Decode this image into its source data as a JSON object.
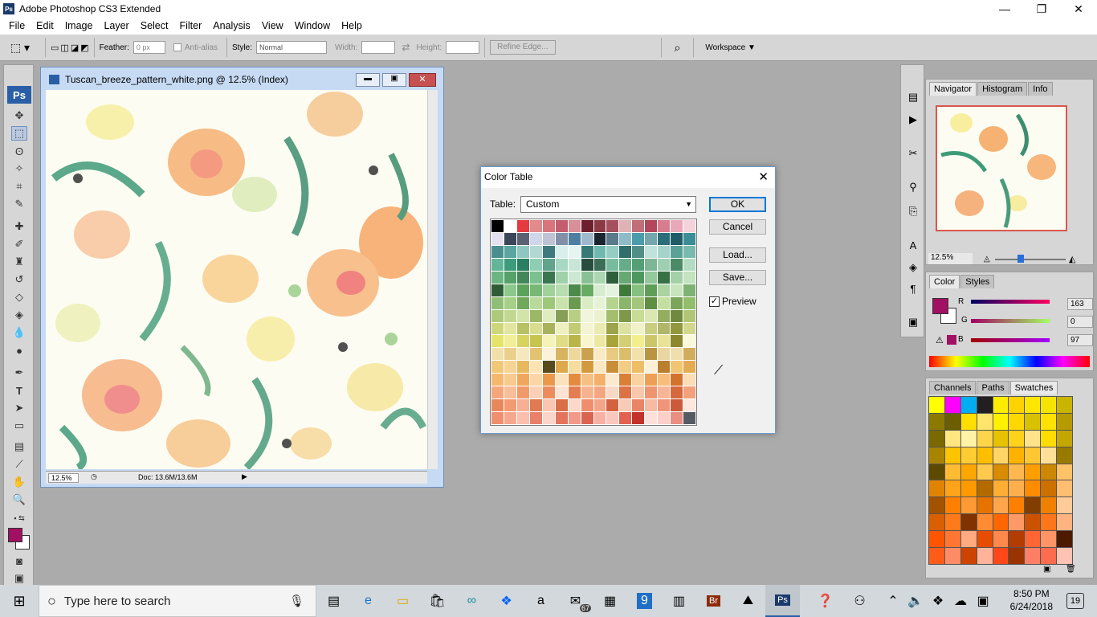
{
  "window": {
    "title": "Adobe Photoshop CS3 Extended",
    "logo": "Ps",
    "min": "—",
    "max": "❐",
    "close": "✕"
  },
  "menu": [
    "File",
    "Edit",
    "Image",
    "Layer",
    "Select",
    "Filter",
    "Analysis",
    "View",
    "Window",
    "Help"
  ],
  "options": {
    "feather_label": "Feather:",
    "feather_value": "0 px",
    "antialias_label": "Anti-alias",
    "style_label": "Style:",
    "style_value": "Normal",
    "width_label": "Width:",
    "height_label": "Height:",
    "refine_label": "Refine Edge...",
    "workspace_label": "Workspace ▼"
  },
  "toolbox": {
    "badge": "Ps"
  },
  "document": {
    "title": "Tuscan_breeze_pattern_white.png @ 12.5% (Index)",
    "zoom": "12.5%",
    "doc_info": "Doc: 13.6M/13.6M"
  },
  "dialog": {
    "title": "Color Table",
    "table_label": "Table:",
    "table_value": "Custom",
    "ok": "OK",
    "cancel": "Cancel",
    "load": "Load...",
    "save": "Save...",
    "preview": "Preview",
    "preview_checked": "✓",
    "palette": [
      "#000000",
      "#ffffff",
      "#e53a3f",
      "#e38a8c",
      "#d9747c",
      "#c45e6e",
      "#d98f97",
      "#6d1f2e",
      "#8c3946",
      "#a6505e",
      "#e0b2b5",
      "#c26d7a",
      "#b3465b",
      "#d87d90",
      "#e9a8b9",
      "#f4d2dc",
      "#e3e0f0",
      "#3b4658",
      "#5a6173",
      "#cfd6e9",
      "#bfc3d3",
      "#8190a8",
      "#4e7fa1",
      "#9fb8cc",
      "#1b2530",
      "#5a7a8c",
      "#8dbcc8",
      "#4a9bab",
      "#74a6ad",
      "#2b6e7a",
      "#1f5c68",
      "#3c8d96",
      "#4a8e8f",
      "#5aa5a1",
      "#8fc7c0",
      "#b3d8d3",
      "#3e7a7d",
      "#d9efec",
      "#e6f4f2",
      "#357a75",
      "#6eb8b0",
      "#95ccc4",
      "#2f6e69",
      "#4f8f88",
      "#c0e2dc",
      "#a3d3ca",
      "#5aa198",
      "#7ab9ae",
      "#63b59a",
      "#3d9a7b",
      "#2a7e61",
      "#90cdb5",
      "#5fa48b",
      "#a8d7c3",
      "#c8e6d7",
      "#284d3e",
      "#3b6d57",
      "#78bc9d",
      "#65ad8a",
      "#53a077",
      "#7eb595",
      "#9fceb2",
      "#4a8a66",
      "#b4dcc2",
      "#6bb583",
      "#55a06b",
      "#42875a",
      "#7dc08f",
      "#3a7550",
      "#9ed1a8",
      "#cde8d2",
      "#89c095",
      "#abd6b1",
      "#2f5e3c",
      "#67a875",
      "#4e9660",
      "#93c89a",
      "#387045",
      "#a4d0a7",
      "#c3e3c1",
      "#2f5c34",
      "#8cc88a",
      "#5ba35a",
      "#77b875",
      "#9fd29b",
      "#b6dcb0",
      "#4b8a48",
      "#68ab63",
      "#d5ecd0",
      "#e4f2df",
      "#3f7a3a",
      "#86c07f",
      "#5e9e56",
      "#a9d39f",
      "#c7e4bd",
      "#7db273",
      "#8fbf74",
      "#a6d087",
      "#72a85c",
      "#b9da9b",
      "#9dc879",
      "#c8e3ad",
      "#6a9a4f",
      "#d9ecc3",
      "#e7f3d7",
      "#b4d48f",
      "#89b669",
      "#a2c77c",
      "#5e8f42",
      "#c4df9f",
      "#7ba558",
      "#92bd6b",
      "#adc97a",
      "#c2d890",
      "#d3e4a7",
      "#9ab865",
      "#e0ebbf",
      "#869f56",
      "#b8cf82",
      "#f0f5dc",
      "#ecf2cf",
      "#a4be6d",
      "#7c9848",
      "#c9dc96",
      "#dbe7b1",
      "#94ad5e",
      "#6f8a3f",
      "#b0c676",
      "#cdd67b",
      "#e2e6a0",
      "#b8c163",
      "#d8dd8f",
      "#a9b25a",
      "#eff0c0",
      "#c3cb73",
      "#f4f4d2",
      "#e9ebb0",
      "#9da348",
      "#dde1a0",
      "#f1f2c9",
      "#c8cd80",
      "#b1b769",
      "#90973c",
      "#d3d78e",
      "#e6e36b",
      "#f1ee98",
      "#d7d35f",
      "#c8c450",
      "#f5f3b7",
      "#e0dc86",
      "#bab547",
      "#f8f6cd",
      "#ede9a4",
      "#a9a43a",
      "#d4cf73",
      "#f3ef8e",
      "#ccc66a",
      "#e8e396",
      "#8c8830",
      "#fbf9dc",
      "#f2e0a9",
      "#ead08a",
      "#f6e8bd",
      "#e3c372",
      "#fbf2d9",
      "#d7b460",
      "#efd89b",
      "#c8a24f",
      "#f8ebc4",
      "#e8cb80",
      "#dcbd6c",
      "#f3e1ad",
      "#bb9442",
      "#ead6a1",
      "#f0dfae",
      "#d0ad5e",
      "#f0c878",
      "#f5d494",
      "#e8b85f",
      "#fbe3b4",
      "#564a1e",
      "#dea84c",
      "#f7dc9f",
      "#d29a3f",
      "#f9e8c3",
      "#c88f38",
      "#f3cd83",
      "#eebd66",
      "#fdf0d7",
      "#b97f2f",
      "#f1c572",
      "#e4ab52",
      "#f5b86f",
      "#f8ca8e",
      "#f0a75b",
      "#fad6a7",
      "#eb9849",
      "#fbe2bd",
      "#e48b3e",
      "#f6c083",
      "#f3b06a",
      "#fce9cf",
      "#db7f35",
      "#f9d2a0",
      "#ef9f55",
      "#f7bd7b",
      "#d2722d",
      "#fbdcb4",
      "#f4a77a",
      "#f8bd99",
      "#f09a6a",
      "#fbd0b7",
      "#ec8c5c",
      "#fde3d4",
      "#e47e50",
      "#f6b48e",
      "#f3a680",
      "#fad8c6",
      "#dc7246",
      "#f9c7ab",
      "#ee9570",
      "#f7b597",
      "#d5683d",
      "#f2a17c",
      "#e8875b",
      "#f29b73",
      "#f6b093",
      "#e17a52",
      "#fac6b1",
      "#da6e48",
      "#fbd8c9",
      "#ef8e6c",
      "#f4a589",
      "#d36240",
      "#f9cab7",
      "#e98466",
      "#f7bba4",
      "#f0957a",
      "#cc5a3a",
      "#fde6dd",
      "#f08f70",
      "#f5a88f",
      "#fac0ad",
      "#ea806a",
      "#fbd5c8",
      "#e3735c",
      "#f2998a",
      "#d96450",
      "#f7b1a3",
      "#f9c7bd",
      "#e46151",
      "#c4302a",
      "#fde0da",
      "#fcd0c8",
      "#e88f82",
      "#555b63"
    ]
  },
  "nav": {
    "tabs": [
      "Navigator",
      "Histogram",
      "Info"
    ],
    "zoom": "12.5%"
  },
  "color": {
    "tabs": [
      "Color",
      "Styles"
    ],
    "r_label": "R",
    "g_label": "G",
    "b_label": "B",
    "r": "163",
    "g": "0",
    "b": "97",
    "fg": "#a21063"
  },
  "swatches": {
    "tabs": [
      "Channels",
      "Paths",
      "Swatches"
    ],
    "colors": [
      "#ffff00",
      "#ff00ff",
      "#00aeef",
      "#231f20",
      "#ffed00",
      "#ffd200",
      "#ffe600",
      "#f5e400",
      "#c9b400",
      "#8c7a00",
      "#6b5e00",
      "#ffde00",
      "#ffe56b",
      "#fff200",
      "#ffd800",
      "#d8c100",
      "#ffe200",
      "#b59b00",
      "#7a6900",
      "#ffe680",
      "#fff3a8",
      "#ffd54a",
      "#e6c200",
      "#ffd31a",
      "#ffe38a",
      "#ffdd00",
      "#c4a600",
      "#a88400",
      "#ffc400",
      "#ffcc33",
      "#ffbf00",
      "#ffd566",
      "#ffb300",
      "#ffc733",
      "#ffe099",
      "#997a00",
      "#5c4a00",
      "#ffbb33",
      "#ffa600",
      "#ffc94d",
      "#d98c00",
      "#ffb84d",
      "#ff9e00",
      "#cc8800",
      "#ffc266",
      "#e08300",
      "#ffa31a",
      "#ff9900",
      "#b36b00",
      "#ffad33",
      "#ffb04d",
      "#ff8c00",
      "#cc7000",
      "#ffbe70",
      "#a35200",
      "#ff8000",
      "#ff9933",
      "#e67300",
      "#ffa64d",
      "#ff7f00",
      "#803f00",
      "#f08000",
      "#ffcc99",
      "#d95f00",
      "#ff7a1a",
      "#803300",
      "#ff8c33",
      "#ff6600",
      "#ff9966",
      "#cc5200",
      "#ff751a",
      "#ffb380",
      "#ff5500",
      "#ff7733",
      "#ffaa80",
      "#e64d00",
      "#ff884d",
      "#b33c00",
      "#ff6633",
      "#ff9466",
      "#4d1a00",
      "#ff5c1a",
      "#ff8c66",
      "#cc4400",
      "#ffb399",
      "#ff471a",
      "#993300",
      "#ff7f66",
      "#ff6b4d",
      "#ffc2b3"
    ]
  },
  "taskbar": {
    "search": "Type here to search",
    "time": "8:50 PM",
    "date": "6/24/2018",
    "notif": "19",
    "mail_badge": "67",
    "calendar_day": "9"
  }
}
